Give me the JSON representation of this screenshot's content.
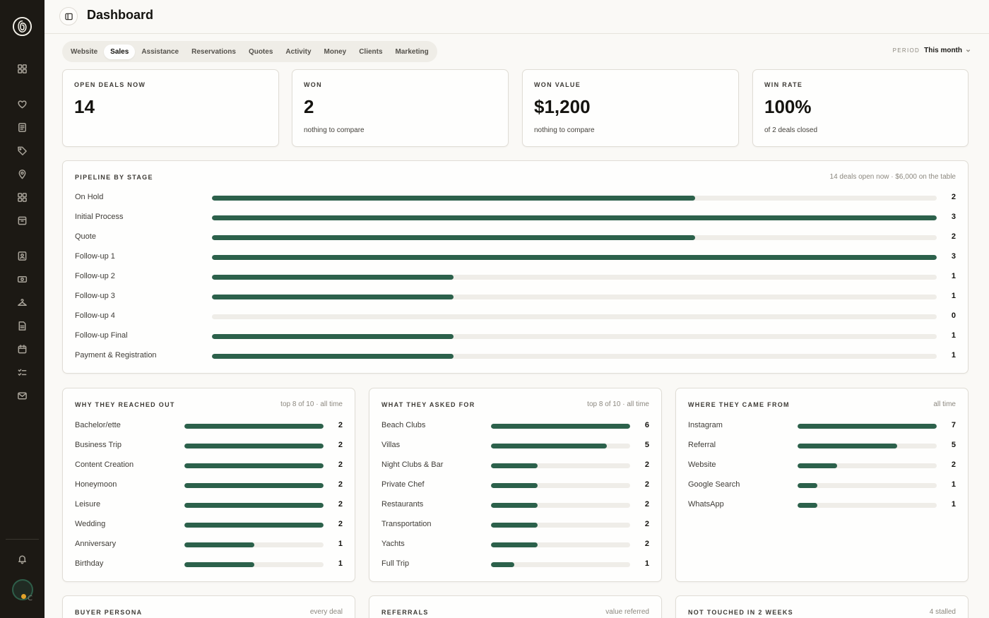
{
  "header": {
    "title": "Dashboard"
  },
  "tabs": [
    {
      "label": "Website",
      "active": false
    },
    {
      "label": "Sales",
      "active": true
    },
    {
      "label": "Assistance",
      "active": false
    },
    {
      "label": "Reservations",
      "active": false
    },
    {
      "label": "Quotes",
      "active": false
    },
    {
      "label": "Activity",
      "active": false
    },
    {
      "label": "Money",
      "active": false
    },
    {
      "label": "Clients",
      "active": false
    },
    {
      "label": "Marketing",
      "active": false
    }
  ],
  "period": {
    "label": "PERIOD",
    "value": "This month"
  },
  "stats": [
    {
      "label": "OPEN DEALS NOW",
      "value": "14",
      "sub": ""
    },
    {
      "label": "WON",
      "value": "2",
      "sub": "nothing to compare"
    },
    {
      "label": "WON VALUE",
      "value": "$1,200",
      "sub": "nothing to compare"
    },
    {
      "label": "WIN RATE",
      "value": "100%",
      "sub": "of 2 deals closed"
    }
  ],
  "pipeline": {
    "title": "PIPELINE BY STAGE",
    "note": "14 deals open now · $6,000 on the table",
    "max": 3,
    "rows": [
      {
        "label": "On Hold",
        "value": 2
      },
      {
        "label": "Initial Process",
        "value": 3
      },
      {
        "label": "Quote",
        "value": 2
      },
      {
        "label": "Follow-up 1",
        "value": 3
      },
      {
        "label": "Follow-up 2",
        "value": 1
      },
      {
        "label": "Follow-up 3",
        "value": 1
      },
      {
        "label": "Follow-up 4",
        "value": 0
      },
      {
        "label": "Follow-up Final",
        "value": 1
      },
      {
        "label": "Payment & Registration",
        "value": 1
      }
    ]
  },
  "panels": [
    {
      "title": "WHY THEY REACHED OUT",
      "note": "top 8 of 10 · all time",
      "max": 2,
      "rows": [
        {
          "label": "Bachelor/ette",
          "value": 2
        },
        {
          "label": "Business Trip",
          "value": 2
        },
        {
          "label": "Content Creation",
          "value": 2
        },
        {
          "label": "Honeymoon",
          "value": 2
        },
        {
          "label": "Leisure",
          "value": 2
        },
        {
          "label": "Wedding",
          "value": 2
        },
        {
          "label": "Anniversary",
          "value": 1
        },
        {
          "label": "Birthday",
          "value": 1
        }
      ]
    },
    {
      "title": "WHAT THEY ASKED FOR",
      "note": "top 8 of 10 · all time",
      "max": 6,
      "rows": [
        {
          "label": "Beach Clubs",
          "value": 6
        },
        {
          "label": "Villas",
          "value": 5
        },
        {
          "label": "Night Clubs & Bar",
          "value": 2
        },
        {
          "label": "Private Chef",
          "value": 2
        },
        {
          "label": "Restaurants",
          "value": 2
        },
        {
          "label": "Transportation",
          "value": 2
        },
        {
          "label": "Yachts",
          "value": 2
        },
        {
          "label": "Full Trip",
          "value": 1
        }
      ]
    },
    {
      "title": "WHERE THEY CAME FROM",
      "note": "all time",
      "max": 7,
      "rows": [
        {
          "label": "Instagram",
          "value": 7
        },
        {
          "label": "Referral",
          "value": 5
        },
        {
          "label": "Website",
          "value": 2
        },
        {
          "label": "Google Search",
          "value": 1
        },
        {
          "label": "WhatsApp",
          "value": 1
        }
      ]
    }
  ],
  "bottom_panels": [
    {
      "title": "BUYER PERSONA",
      "note": "every deal"
    },
    {
      "title": "REFERRALS",
      "note": "value referred"
    },
    {
      "title": "NOT TOUCHED IN 2 WEEKS",
      "note": "4 stalled"
    }
  ],
  "sidebar": {
    "icons": [
      "dashboard-icon",
      "heart-icon",
      "document-icon",
      "tag-icon",
      "location-icon",
      "grid-icon",
      "archive-icon",
      "contacts-icon",
      "money-icon",
      "hanger-icon",
      "file-icon",
      "calendar-icon",
      "checklist-icon",
      "mail-icon"
    ],
    "bell": "bell-icon",
    "avatar_letter": "C"
  },
  "colors": {
    "accent": "#2c614b",
    "sidebar": "#1c1914",
    "track": "#efede8",
    "background": "#faf9f6"
  }
}
